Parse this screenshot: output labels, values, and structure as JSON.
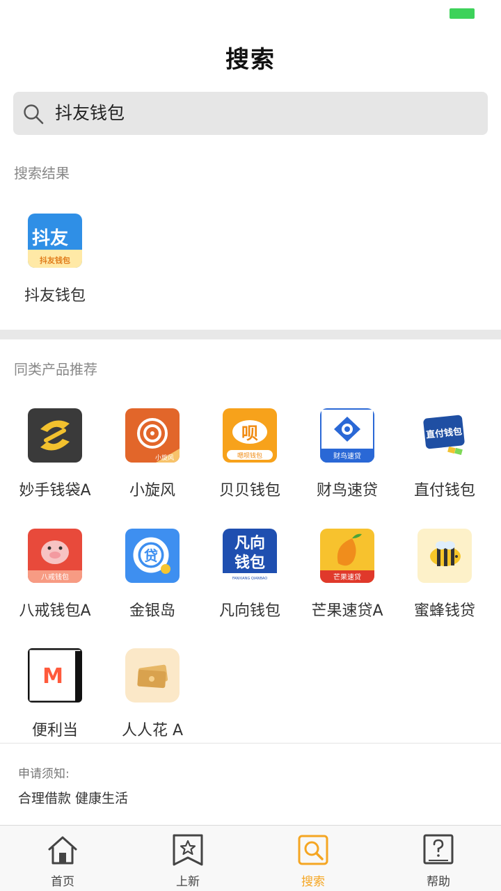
{
  "page_title": "搜索",
  "search": {
    "query": "抖友钱包"
  },
  "results": {
    "label": "搜索结果",
    "items": [
      {
        "name": "抖友钱包",
        "icon": "douyou-wallet-icon",
        "icon_text_top": "抖友",
        "icon_text_bottom": "抖友钱包"
      }
    ]
  },
  "recommend": {
    "label": "同类产品推荐",
    "items": [
      {
        "name": "妙手钱袋A"
      },
      {
        "name": "小旋风",
        "icon_badge": "小旋风"
      },
      {
        "name": "贝贝钱包",
        "icon_glyph": "呗",
        "icon_badge": "嗯呗钱包"
      },
      {
        "name": "财鸟速贷",
        "icon_badge": "财鸟速贷"
      },
      {
        "name": "直付钱包",
        "icon_glyph": "直付钱包"
      },
      {
        "name": "八戒钱包A",
        "icon_badge": "八戒钱包"
      },
      {
        "name": "金银岛",
        "icon_glyph": "贷"
      },
      {
        "name": "凡向钱包",
        "icon_glyph_top": "凡向",
        "icon_glyph_bottom": "钱包",
        "icon_small": "FANXIANG QIANBAO"
      },
      {
        "name": "芒果速贷A",
        "icon_badge": "芒果速贷"
      },
      {
        "name": "蜜蜂钱贷"
      },
      {
        "name": "便利当",
        "icon_glyph": "M"
      },
      {
        "name": "人人花 A"
      }
    ]
  },
  "notice": {
    "title": "申请须知:",
    "text": "合理借款 健康生活"
  },
  "tabs": [
    {
      "label": "首页",
      "icon": "home-icon"
    },
    {
      "label": "上新",
      "icon": "star-bookmark-icon"
    },
    {
      "label": "搜索",
      "icon": "search-tab-icon",
      "active": true
    },
    {
      "label": "帮助",
      "icon": "help-icon"
    }
  ],
  "colors": {
    "accent": "#f5a623",
    "battery": "#3dd25a",
    "search_bg": "#e6e6e6"
  }
}
